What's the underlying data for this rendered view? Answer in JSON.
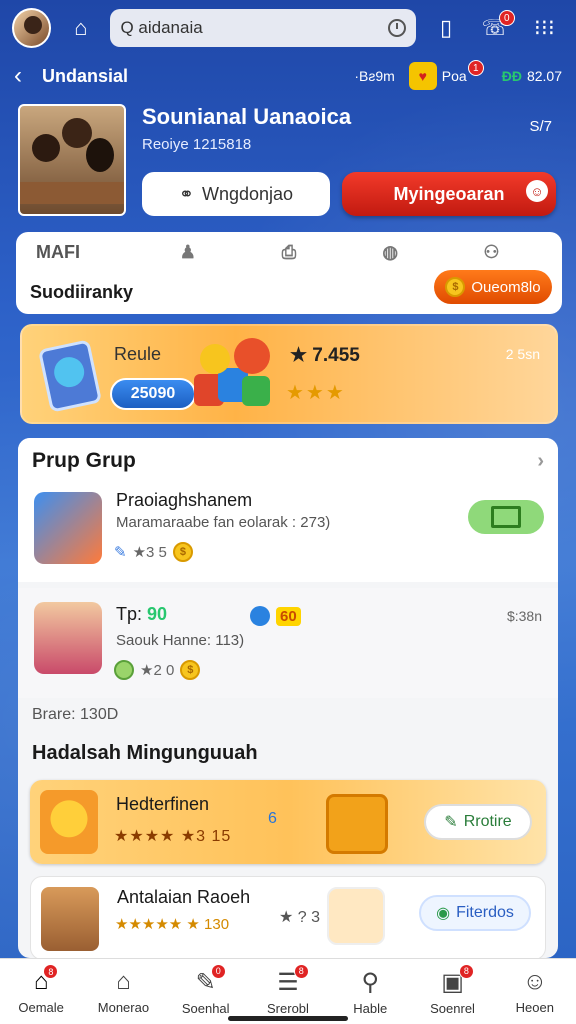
{
  "topbar": {
    "search_value": "Q aidanaia",
    "badge_chat": "0"
  },
  "subbar": {
    "title": "Undansial",
    "stat1": "·Bƨ9m",
    "stat2": "Poa",
    "stat2_badge": "1",
    "stat3_a": "ÐÐ",
    "stat3_b": "82.07"
  },
  "profile": {
    "name": "Sounianal Uanaoica",
    "meta": "Reoiye 1215818",
    "side": "S/7",
    "btn_outline": "Wngdonjao",
    "btn_red": "Myingeoaran"
  },
  "tabs": {
    "items": [
      "MAFI",
      "♟",
      "⎙",
      "◍",
      "⚇"
    ],
    "label": "Suodiiranky",
    "pill": "Oueom8lo"
  },
  "promo": {
    "title": "Reule",
    "value": "25090",
    "count": "★ 7.455",
    "stars": "★★★",
    "time": "2 5sn"
  },
  "group": {
    "header": "Prup Grup",
    "item1": {
      "title": "Praoiaghshanem",
      "sub": "Maramaraabe fan eolarak : 273)",
      "row": "★3 5"
    },
    "item2": {
      "title_a": "Tp:",
      "title_b": "90",
      "tag": "60",
      "sub": "Saouk Hanne: 113)",
      "row": "★2 0",
      "time": "$:38n"
    },
    "brate": "Brare: 130D",
    "section": "Hadalsah Mingunguuah",
    "reward1": {
      "title": "Hedterfinen",
      "stars": "★★★★ ★3 15",
      "mid": "6",
      "button": "Rrotire"
    },
    "reward2": {
      "title": "Antalaian Raoeh",
      "stars": "★★★★★ ★ 130",
      "mid": "★ ? 3",
      "button": "Fiterdos"
    }
  },
  "nav": [
    {
      "label": "Oemale",
      "badge": "8"
    },
    {
      "label": "Monerao",
      "badge": ""
    },
    {
      "label": "Soenhal",
      "badge": "0"
    },
    {
      "label": "Srerobl",
      "badge": "8"
    },
    {
      "label": "Hable",
      "badge": ""
    },
    {
      "label": "Soenrel",
      "badge": "8"
    },
    {
      "label": "Heoen",
      "badge": ""
    }
  ]
}
